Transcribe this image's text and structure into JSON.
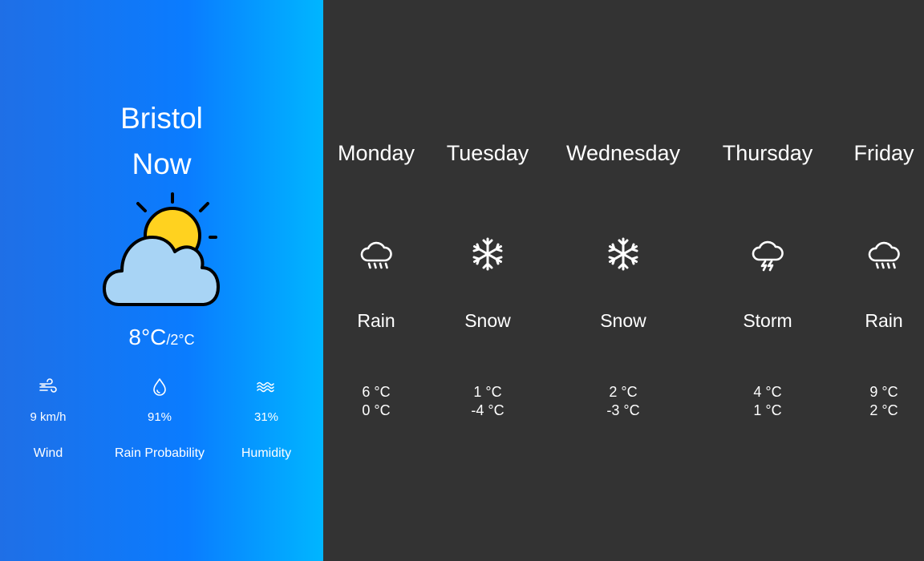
{
  "current": {
    "city": "Bristol",
    "when": "Now",
    "icon": "partly-cloudy-icon",
    "temp_high": "8°C",
    "temp_low": "/2°C",
    "stats": [
      {
        "icon": "wind-icon",
        "value": "9 km/h",
        "label": "Wind"
      },
      {
        "icon": "raindrop-icon",
        "value": "91%",
        "label": "Rain Probability"
      },
      {
        "icon": "humidity-waves-icon",
        "value": "31%",
        "label": "Humidity"
      }
    ]
  },
  "forecast": [
    {
      "day": "Monday",
      "icon": "rain-cloud-icon",
      "condition": "Rain",
      "high": "6 °C",
      "low": "0 °C"
    },
    {
      "day": "Tuesday",
      "icon": "snowflake-icon",
      "condition": "Snow",
      "high": "1 °C",
      "low": "-4 °C"
    },
    {
      "day": "Wednesday",
      "icon": "snowflake-icon",
      "condition": "Snow",
      "high": "2 °C",
      "low": "-3 °C"
    },
    {
      "day": "Thursday",
      "icon": "storm-cloud-icon",
      "condition": "Storm",
      "high": "4 °C",
      "low": "1 °C"
    },
    {
      "day": "Friday",
      "icon": "rain-cloud-icon",
      "condition": "Rain",
      "high": "9 °C",
      "low": "2 °C"
    }
  ],
  "colors": {
    "left_gradient_start": "#1f6fe6",
    "left_gradient_mid": "#0a7cff",
    "left_gradient_end": "#00b6ff",
    "right_background": "#333333",
    "sun": "#ffd21f",
    "cloud": "#a8d4f5"
  }
}
